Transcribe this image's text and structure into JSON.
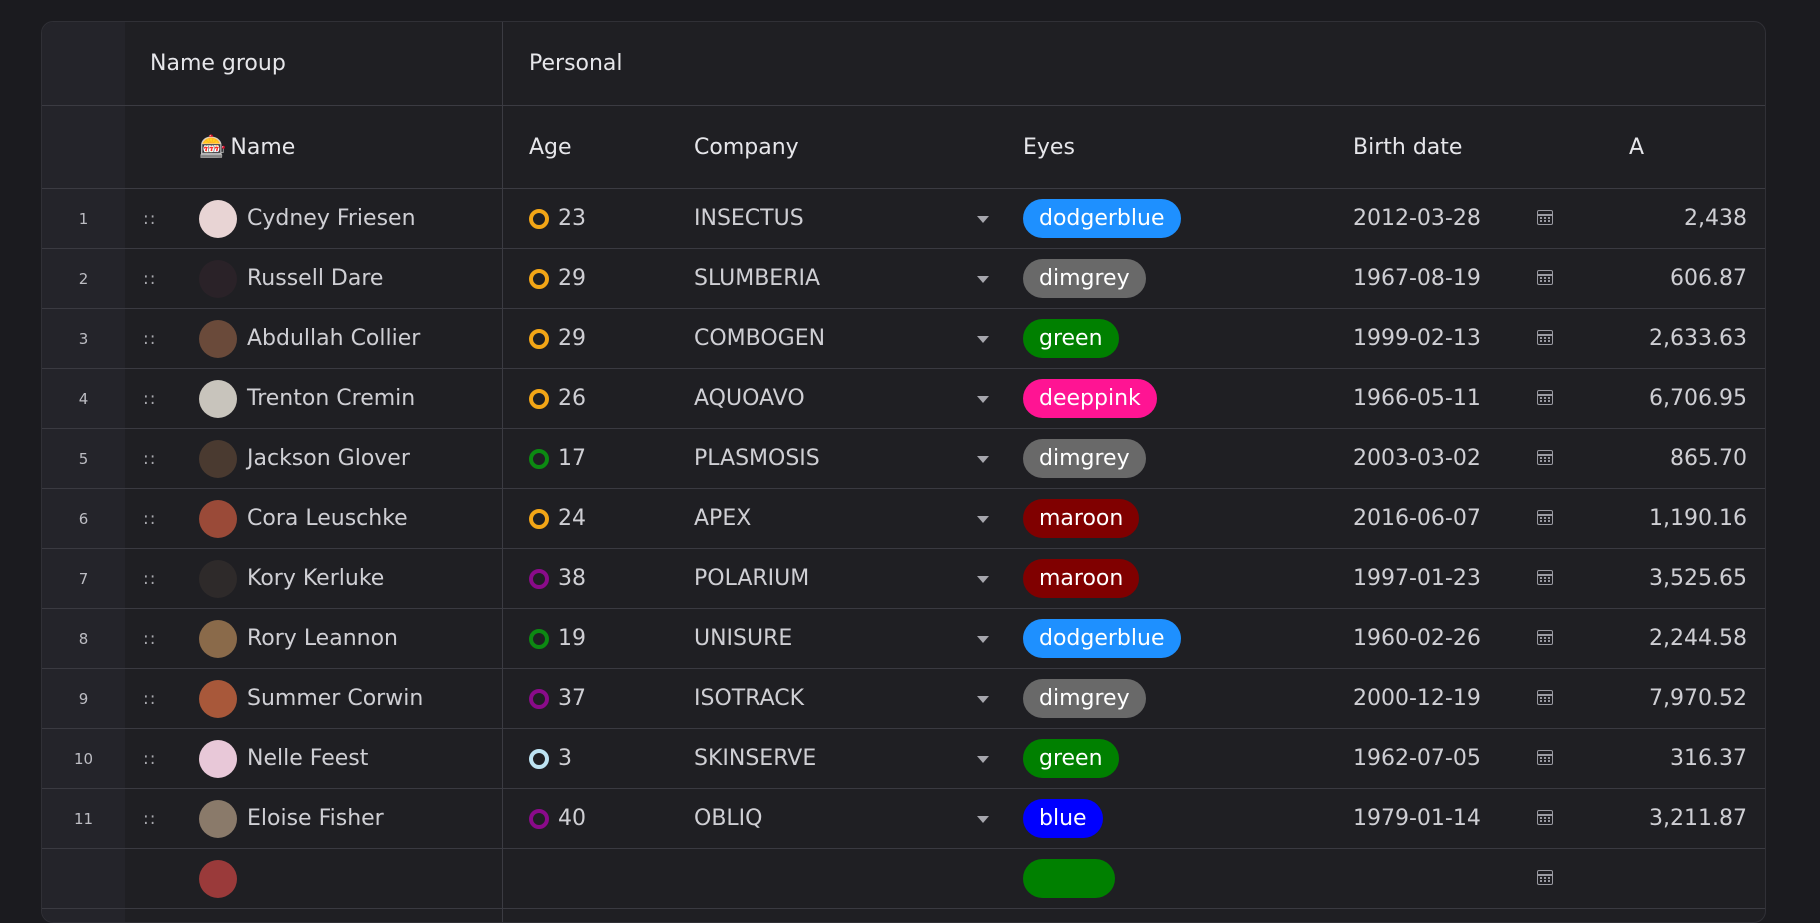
{
  "header": {
    "group_name": "Name group",
    "group_personal": "Personal",
    "col_name_icon": "🎰",
    "col_name": "Name",
    "col_age": "Age",
    "col_company": "Company",
    "col_eyes": "Eyes",
    "col_birth": "Birth date",
    "col_amount": "A"
  },
  "colors": {
    "background": "#1b1b1f",
    "grid": "#1f1f23",
    "ring_orange": "#f2a516",
    "ring_green": "#0c8a12",
    "ring_purple": "#8a0a8a",
    "ring_lightblue": "#bde3f2"
  },
  "rows": [
    {
      "num": "1",
      "drag": "::",
      "name": "Cydney Friesen",
      "avatar_color": "#e8d4d4",
      "ring": "#f2a516",
      "age": "23",
      "company": "INSECTUS",
      "eyes": "dodgerblue",
      "eyes_color": "#1e90ff",
      "birth": "2012-03-28",
      "amount": "2,438"
    },
    {
      "num": "2",
      "drag": "::",
      "name": "Russell Dare",
      "avatar_color": "#2a2228",
      "ring": "#f2a516",
      "age": "29",
      "company": "SLUMBERIA",
      "eyes": "dimgrey",
      "eyes_color": "#696969",
      "birth": "1967-08-19",
      "amount": "606.87"
    },
    {
      "num": "3",
      "drag": "::",
      "name": "Abdullah Collier",
      "avatar_color": "#6a4a3a",
      "ring": "#f2a516",
      "age": "29",
      "company": "COMBOGEN",
      "eyes": "green",
      "eyes_color": "#008000",
      "birth": "1999-02-13",
      "amount": "2,633.63"
    },
    {
      "num": "4",
      "drag": "::",
      "name": "Trenton Cremin",
      "avatar_color": "#c8c4bc",
      "ring": "#f2a516",
      "age": "26",
      "company": "AQUOAVO",
      "eyes": "deeppink",
      "eyes_color": "#ff1493",
      "birth": "1966-05-11",
      "amount": "6,706.95"
    },
    {
      "num": "5",
      "drag": "::",
      "name": "Jackson Glover",
      "avatar_color": "#4a3a30",
      "ring": "#0c8a12",
      "age": "17",
      "company": "PLASMOSIS",
      "eyes": "dimgrey",
      "eyes_color": "#696969",
      "birth": "2003-03-02",
      "amount": "865.70"
    },
    {
      "num": "6",
      "drag": "::",
      "name": "Cora Leuschke",
      "avatar_color": "#9a4a38",
      "ring": "#f2a516",
      "age": "24",
      "company": "APEX",
      "eyes": "maroon",
      "eyes_color": "#800000",
      "birth": "2016-06-07",
      "amount": "1,190.16"
    },
    {
      "num": "7",
      "drag": "::",
      "name": "Kory Kerluke",
      "avatar_color": "#2e2a2a",
      "ring": "#8a0a8a",
      "age": "38",
      "company": "POLARIUM",
      "eyes": "maroon",
      "eyes_color": "#800000",
      "birth": "1997-01-23",
      "amount": "3,525.65"
    },
    {
      "num": "8",
      "drag": "::",
      "name": "Rory Leannon",
      "avatar_color": "#8a6a4a",
      "ring": "#0c8a12",
      "age": "19",
      "company": "UNISURE",
      "eyes": "dodgerblue",
      "eyes_color": "#1e90ff",
      "birth": "1960-02-26",
      "amount": "2,244.58"
    },
    {
      "num": "9",
      "drag": "::",
      "name": "Summer Corwin",
      "avatar_color": "#a8583a",
      "ring": "#8a0a8a",
      "age": "37",
      "company": "ISOTRACK",
      "eyes": "dimgrey",
      "eyes_color": "#696969",
      "birth": "2000-12-19",
      "amount": "7,970.52"
    },
    {
      "num": "10",
      "drag": "::",
      "name": "Nelle Feest",
      "avatar_color": "#e8c8d8",
      "ring": "#bde3f2",
      "age": "3",
      "company": "SKINSERVE",
      "eyes": "green",
      "eyes_color": "#008000",
      "birth": "1962-07-05",
      "amount": "316.37"
    },
    {
      "num": "11",
      "drag": "::",
      "name": "Eloise Fisher",
      "avatar_color": "#8a7a6a",
      "ring": "#8a0a8a",
      "age": "40",
      "company": "OBLIQ",
      "eyes": "blue",
      "eyes_color": "#0000ff",
      "birth": "1979-01-14",
      "amount": "3,211.87"
    },
    {
      "num": "",
      "drag": "",
      "name": "",
      "avatar_color": "#9a3a3a",
      "ring": "",
      "age": "",
      "company": "",
      "eyes": "",
      "eyes_color": "#008000",
      "birth": "",
      "amount": ""
    }
  ]
}
